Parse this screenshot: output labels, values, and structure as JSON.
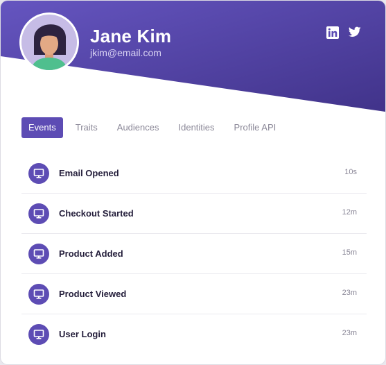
{
  "profile": {
    "name": "Jane Kim",
    "email": "jkim@email.com"
  },
  "social": [
    {
      "icon": "linkedin-icon"
    },
    {
      "icon": "twitter-icon"
    }
  ],
  "tabs": [
    {
      "label": "Events",
      "active": true
    },
    {
      "label": "Traits"
    },
    {
      "label": "Audiences"
    },
    {
      "label": "Identities"
    },
    {
      "label": "Profile API"
    }
  ],
  "events": [
    {
      "label": "Email Opened",
      "time": "10s",
      "icon": "monitor-icon"
    },
    {
      "label": "Checkout Started",
      "time": "12m",
      "icon": "monitor-icon"
    },
    {
      "label": "Product Added",
      "time": "15m",
      "icon": "monitor-icon"
    },
    {
      "label": "Product Viewed",
      "time": "23m",
      "icon": "monitor-icon"
    },
    {
      "label": "User Login",
      "time": "23m",
      "icon": "monitor-icon"
    }
  ],
  "colors": {
    "accent": "#5d4cb4",
    "header_dark": "#4a3a97",
    "header_light": "#6555c0"
  }
}
